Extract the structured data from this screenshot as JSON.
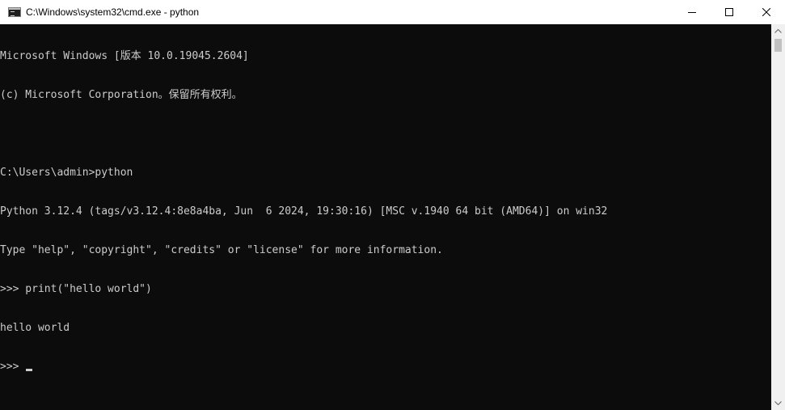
{
  "window": {
    "title": "C:\\Windows\\system32\\cmd.exe - python",
    "icon": "cmd-console-icon",
    "controls": {
      "minimize": "minimize-icon",
      "maximize": "maximize-icon",
      "close": "close-icon"
    }
  },
  "console": {
    "lines": [
      "Microsoft Windows [版本 10.0.19045.2604]",
      "(c) Microsoft Corporation。保留所有权利。",
      "",
      "C:\\Users\\admin>python",
      "Python 3.12.4 (tags/v3.12.4:8e8a4ba, Jun  6 2024, 19:30:16) [MSC v.1940 64 bit (AMD64)] on win32",
      "Type \"help\", \"copyright\", \"credits\" or \"license\" for more information.",
      ">>> print(\"hello world\")",
      "hello world"
    ],
    "prompt": ">>> "
  },
  "colors": {
    "console_bg": "#0c0c0c",
    "console_text": "#cccccc",
    "titlebar_bg": "#ffffff"
  }
}
